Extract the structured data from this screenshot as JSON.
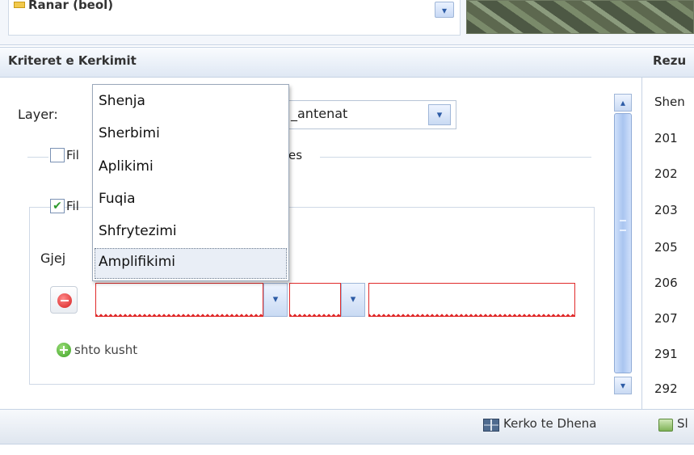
{
  "top": {
    "tree_item_label": "Ranar (beol)"
  },
  "criteria_panel": {
    "title": "Kriteret e Kerkimit",
    "layer_label": "Layer:",
    "layer_value": "_antenat",
    "filter1_label": "Fil",
    "filter1_tail": "es",
    "filter2_label": "Fil",
    "filter2_checked": true,
    "find_label": "Gjej",
    "add_condition_label": "shto kusht"
  },
  "dropdown": {
    "options": [
      "Shenja",
      "Sherbimi",
      "Aplikimi",
      "Fuqia",
      "Shfrytezimi",
      "Amplifikimi"
    ],
    "selected": "Amplifikimi"
  },
  "results_panel": {
    "title": "Rezu",
    "column_header": "Shen",
    "rows": [
      "201",
      "202",
      "203",
      "205",
      "206",
      "207",
      "291",
      "292"
    ]
  },
  "toolbar": {
    "search_data_label": "Kerko te Dhena",
    "export_label": "Sl"
  },
  "icons": {
    "tree": "folder-icon",
    "remove": "remove-condition-icon",
    "add": "add-condition-icon",
    "search_data": "table-icon",
    "export": "export-icon"
  },
  "colors": {
    "accent": "#9fb6d8",
    "invalid_border": "#e02a2a",
    "add_green": "#3aa024",
    "remove_red": "#d61f1f"
  }
}
